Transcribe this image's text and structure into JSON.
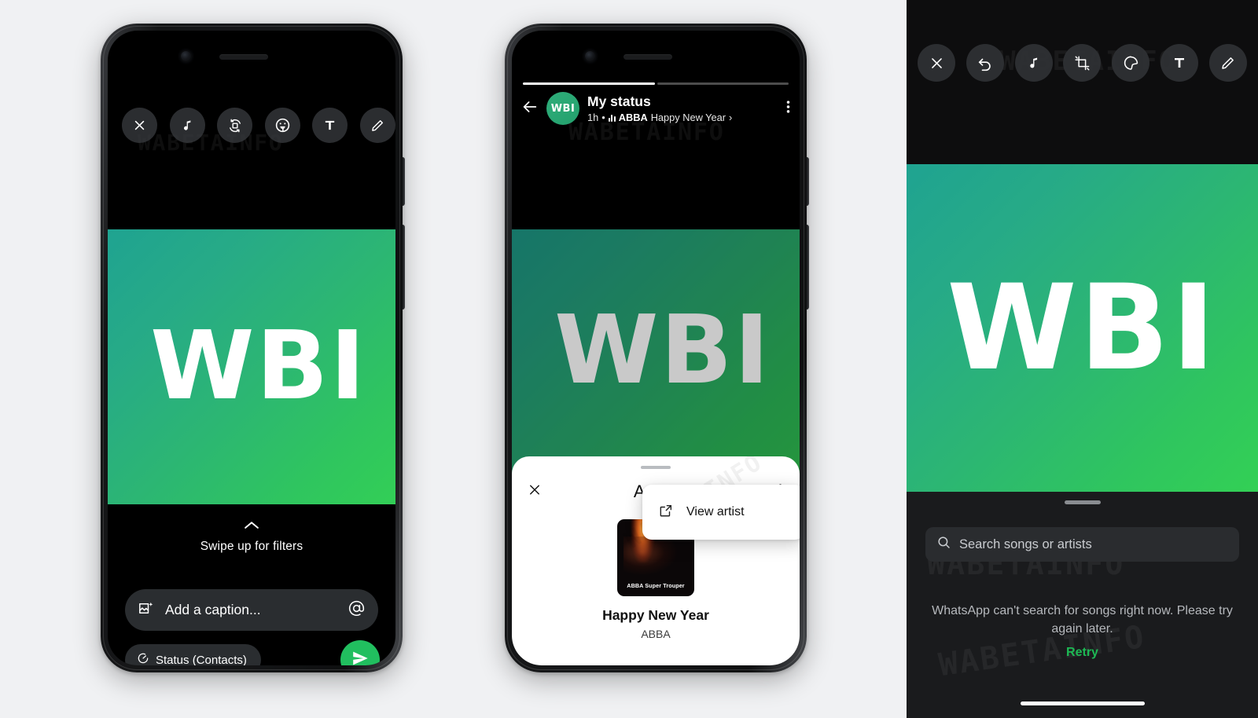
{
  "background_color": "#f0f1f3",
  "brand": {
    "watermark": "WABETAINFO",
    "accent_green": "#21bf5f",
    "image_logo": "WBI"
  },
  "phone1": {
    "name": "status-composer",
    "toolbar": [
      {
        "icon": "close-icon",
        "label": "Close"
      },
      {
        "icon": "music-note-icon",
        "label": "Add music"
      },
      {
        "icon": "crop-rotate-icon",
        "label": "Crop and rotate"
      },
      {
        "icon": "sticker-icon",
        "label": "Sticker"
      },
      {
        "icon": "text-icon",
        "label": "T"
      },
      {
        "icon": "pencil-icon",
        "label": "Draw"
      }
    ],
    "filters_hint": "Swipe up for filters",
    "caption": {
      "placeholder": "Add a caption...",
      "left_icon": "photo-sparkle-icon",
      "right_icon": "mention-at-icon"
    },
    "audience_chip": {
      "label": "Status (Contacts)",
      "icon": "status-ring-icon"
    },
    "send_button": {
      "label": "Send",
      "icon": "send-plane-icon"
    }
  },
  "phone2": {
    "name": "status-viewer",
    "header": {
      "back_icon": "back-arrow-icon",
      "avatar_initials": "WBI",
      "title": "My status",
      "time": "1h",
      "separator": "•",
      "music_icon": "equalizer-icon",
      "artist": "ABBA",
      "song": "Happy New Year",
      "chevron": "›",
      "kebab_icon": "more-vertical-icon"
    },
    "progress": {
      "segments": 2,
      "active_index": 0
    },
    "audio_sheet": {
      "title": "Audio",
      "close_icon": "close-icon",
      "kebab_icon": "more-vertical-icon",
      "album_caption": "ABBA Super Trouper",
      "track_title": "Happy New Year",
      "track_artist": "ABBA",
      "menu": {
        "icon": "open-external-icon",
        "label": "View artist"
      }
    }
  },
  "right_panel": {
    "name": "music-picker",
    "toolbar": [
      {
        "icon": "close-icon",
        "label": "Close"
      },
      {
        "icon": "undo-icon",
        "label": "Undo"
      },
      {
        "icon": "music-note-icon",
        "label": "Add music"
      },
      {
        "icon": "crop-icon",
        "label": "Crop"
      },
      {
        "icon": "sticker-icon",
        "label": "Sticker"
      },
      {
        "icon": "text-icon",
        "label": "T"
      },
      {
        "icon": "pencil-icon",
        "label": "Draw"
      }
    ],
    "search": {
      "placeholder": "Search songs or artists",
      "icon": "search-icon",
      "value": ""
    },
    "empty_state": "WhatsApp can't search for songs right now. Please try again later.",
    "retry_label": "Retry"
  }
}
